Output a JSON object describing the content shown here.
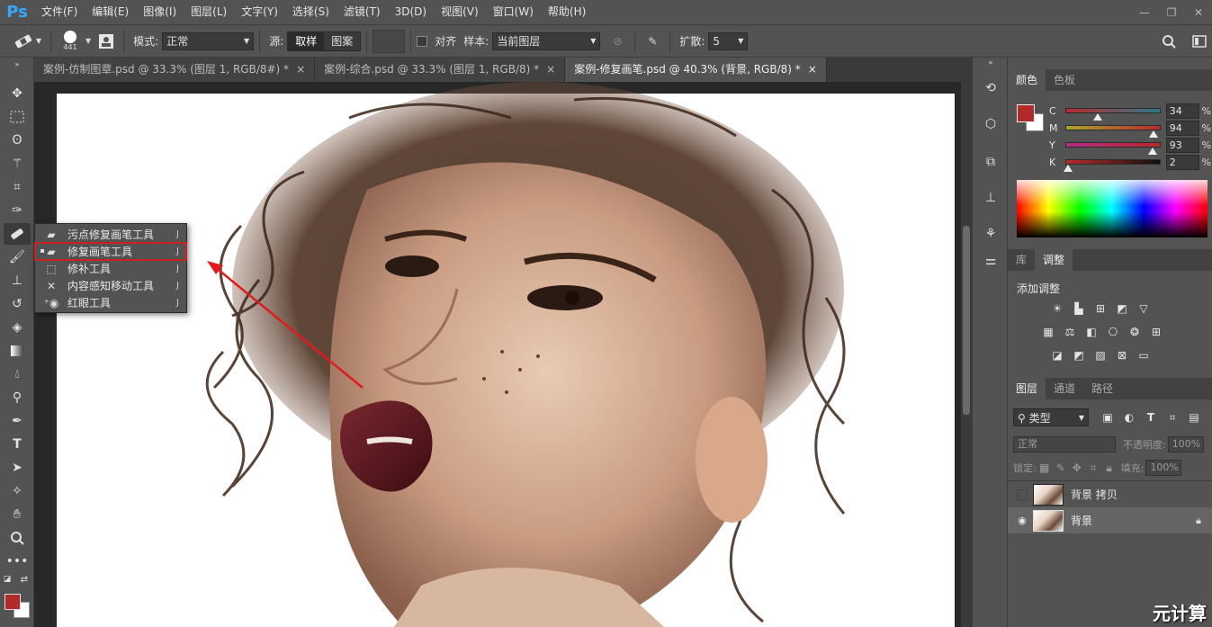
{
  "app": {
    "logo": "Ps"
  },
  "menu": [
    "文件(F)",
    "编辑(E)",
    "图像(I)",
    "图层(L)",
    "文字(Y)",
    "选择(S)",
    "滤镜(T)",
    "3D(D)",
    "视图(V)",
    "窗口(W)",
    "帮助(H)"
  ],
  "window_controls": {
    "minimize": "—",
    "restore": "❐",
    "close": "✕"
  },
  "options": {
    "brush_size": "441",
    "mode_label": "模式:",
    "mode_value": "正常",
    "source_label": "源:",
    "source_sampled": "取样",
    "source_pattern": "图案",
    "align_label": "对齐",
    "sample_label": "样本:",
    "sample_value": "当前图层",
    "diffusion_label": "扩散:",
    "diffusion_value": "5"
  },
  "tabs": [
    {
      "title": "案例-仿制图章.psd @ 33.3% (图层 1, RGB/8#) *",
      "close": "×"
    },
    {
      "title": "案例-综合.psd @ 33.3% (图层 1, RGB/8) *",
      "close": "×"
    },
    {
      "title": "案例-修复画笔.psd @ 40.3% (背景, RGB/8) *",
      "close": "×"
    }
  ],
  "flyout": {
    "items": [
      {
        "label": "污点修复画笔工具",
        "key": "J",
        "icon": "spot-healing-icon"
      },
      {
        "label": "修复画笔工具",
        "key": "J",
        "icon": "healing-brush-icon"
      },
      {
        "label": "修补工具",
        "key": "J",
        "icon": "patch-icon"
      },
      {
        "label": "内容感知移动工具",
        "key": "J",
        "icon": "content-aware-move-icon"
      },
      {
        "label": "红眼工具",
        "key": "J",
        "icon": "red-eye-icon"
      }
    ]
  },
  "color_panel": {
    "tabs": [
      "颜色",
      "色板"
    ],
    "channels": [
      {
        "label": "C",
        "value": "34",
        "fraction": 0.34
      },
      {
        "label": "M",
        "value": "94",
        "fraction": 0.94
      },
      {
        "label": "Y",
        "value": "93",
        "fraction": 0.93
      },
      {
        "label": "K",
        "value": "2",
        "fraction": 0.02
      }
    ],
    "pct": "%",
    "foreground": "#b02a2a"
  },
  "adjust_panel": {
    "tabs": [
      "库",
      "调整"
    ],
    "title": "添加调整"
  },
  "layers_panel": {
    "tabs": [
      "图层",
      "通道",
      "路径"
    ],
    "filter_kind": "类型",
    "blend_mode": "正常",
    "opacity_label": "不透明度:",
    "opacity_value": "100%",
    "lock_label": "锁定:",
    "fill_label": "填充:",
    "fill_value": "100%",
    "layers": [
      {
        "name": "背景 拷贝",
        "visible": false
      },
      {
        "name": "背景",
        "visible": true
      }
    ]
  },
  "watermark": "元计算"
}
